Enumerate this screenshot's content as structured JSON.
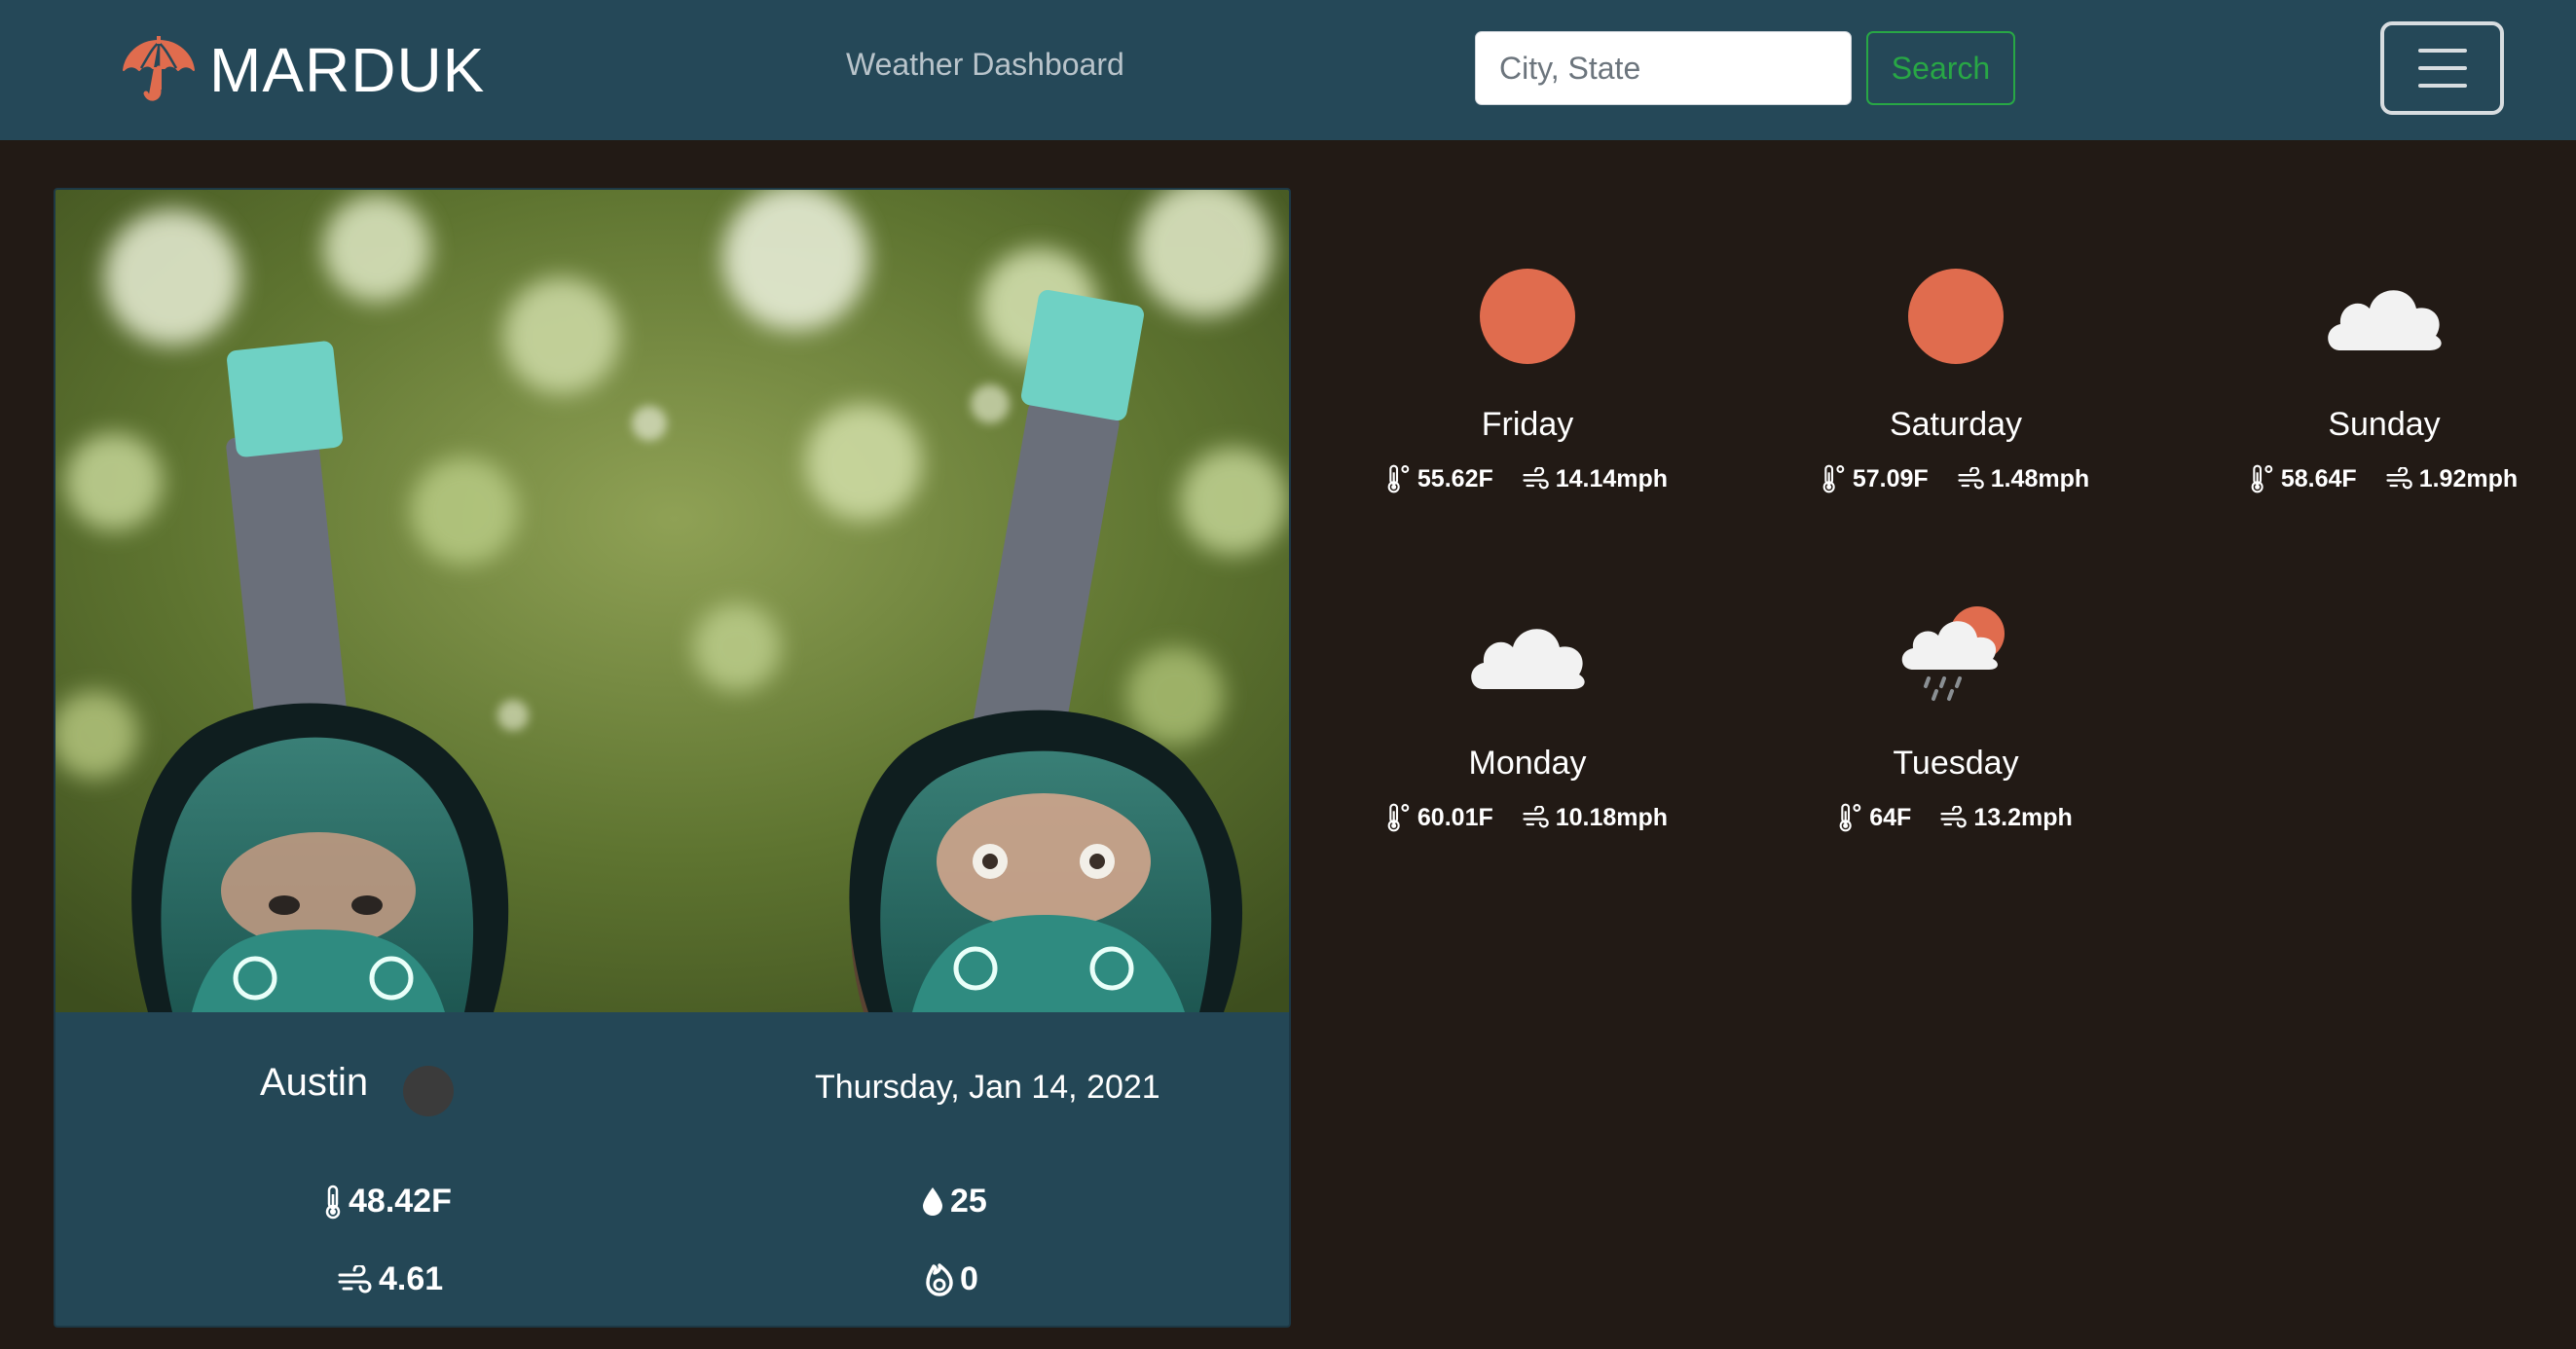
{
  "nav": {
    "brand": "MARDUK",
    "brand_icon": "umbrella-icon",
    "link": "Weather Dashboard",
    "search_placeholder": "City, State",
    "search_button": "Search",
    "menu_icon": "hamburger-icon"
  },
  "colors": {
    "navbar": "#254858",
    "page_background": "#221a15",
    "accent": "#e06c4e",
    "search_green": "#28a745",
    "card": "#244756"
  },
  "current": {
    "photo": "photo of two people wearing teal full-face snorkel masks",
    "city": "Austin",
    "date": "Thursday, Jan 14, 2021",
    "temperature": "48.42F",
    "humidity": "25",
    "wind": "4.61",
    "uv_index": "0"
  },
  "forecast": [
    {
      "day": "Friday",
      "icon": "sun-icon",
      "temp": "55.62F",
      "wind": "14.14mph"
    },
    {
      "day": "Saturday",
      "icon": "sun-icon",
      "temp": "57.09F",
      "wind": "1.48mph"
    },
    {
      "day": "Sunday",
      "icon": "cloud-icon",
      "temp": "58.64F",
      "wind": "1.92mph"
    },
    {
      "day": "Monday",
      "icon": "cloud-icon",
      "temp": "60.01F",
      "wind": "10.18mph"
    },
    {
      "day": "Tuesday",
      "icon": "rain-sun-icon",
      "temp": "64F",
      "wind": "13.2mph"
    }
  ]
}
